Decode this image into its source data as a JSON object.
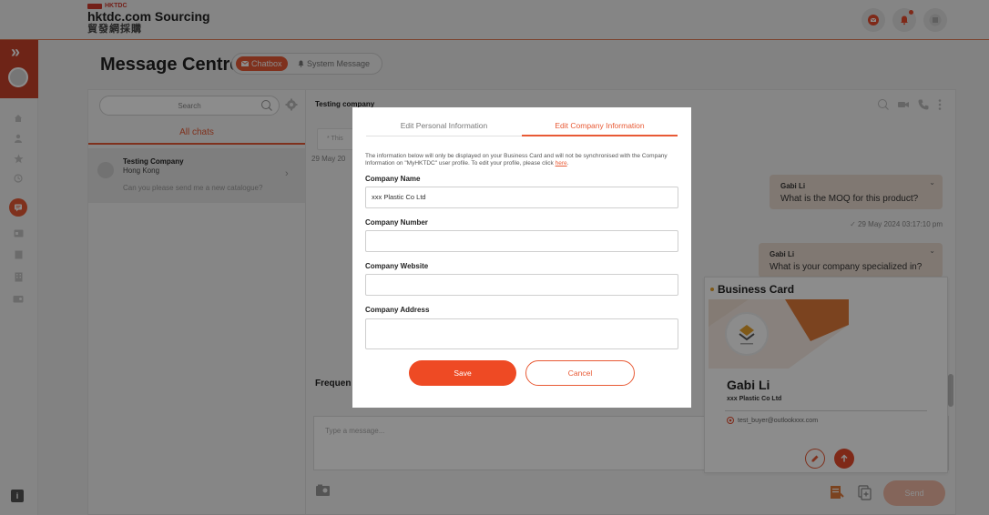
{
  "header": {
    "logo_brand": "HKTDC",
    "logo_title": "hktdc.com Sourcing",
    "logo_subtitle": "貿發網採購",
    "icons": [
      "mail-icon",
      "bell-icon",
      "menu-icon"
    ]
  },
  "sidebar": {
    "expand_glyph": "»",
    "items": [
      "home-icon",
      "user-icon",
      "star-icon",
      "history-icon",
      "chat-icon",
      "card-icon",
      "document-icon",
      "building-icon",
      "photo-icon"
    ],
    "active": "chat-icon",
    "info_glyph": "i"
  },
  "page": {
    "title": "Message Centre",
    "tab_chatbox": "Chatbox",
    "tab_system": "System Message"
  },
  "chat_list": {
    "search_placeholder": "Search",
    "tab_all": "All chats",
    "items": [
      {
        "name": "Testing Company",
        "location": "Hong Kong",
        "last_message": "Can you please send me a new catalogue?"
      }
    ]
  },
  "conversation": {
    "title": "Testing company",
    "system_note": "* This",
    "date_prefix": "29 May 20",
    "messages": [
      {
        "sender": "Gabi Li",
        "text": "What is the MOQ for this product?",
        "time": "29 May 2024 03:17:10 pm"
      },
      {
        "sender": "Gabi Li",
        "text": "What is your company specialized in?"
      }
    ],
    "frequent_label": "Frequen",
    "composer_placeholder": "Type a message...",
    "send_label": "Send"
  },
  "business_card": {
    "title": "Business Card",
    "name": "Gabi Li",
    "company": "xxx Plastic Co Ltd",
    "email": "test_buyer@outlookxxx.com",
    "accent": "#e07a3a"
  },
  "modal": {
    "tab_personal": "Edit Personal Information",
    "tab_company": "Edit Company Information",
    "note_text": "The information below will only be displayed on your Business Card and will not be synchronised with the Company Information on \"MyHKTDC\" user profile. To edit your profile, please click ",
    "note_link": "here",
    "note_end": ".",
    "fields": {
      "company_name_label": "Company Name",
      "company_name_value": "xxx  Plastic Co Ltd",
      "company_number_label": "Company Number",
      "company_number_value": "",
      "company_website_label": "Company Website",
      "company_website_value": "",
      "company_address_label": "Company Address",
      "company_address_value": ""
    },
    "save_label": "Save",
    "cancel_label": "Cancel"
  },
  "colors": {
    "accent": "#e85a35",
    "brand_red": "#c9432b",
    "overlay": "rgba(0,0,0,0.45)"
  }
}
